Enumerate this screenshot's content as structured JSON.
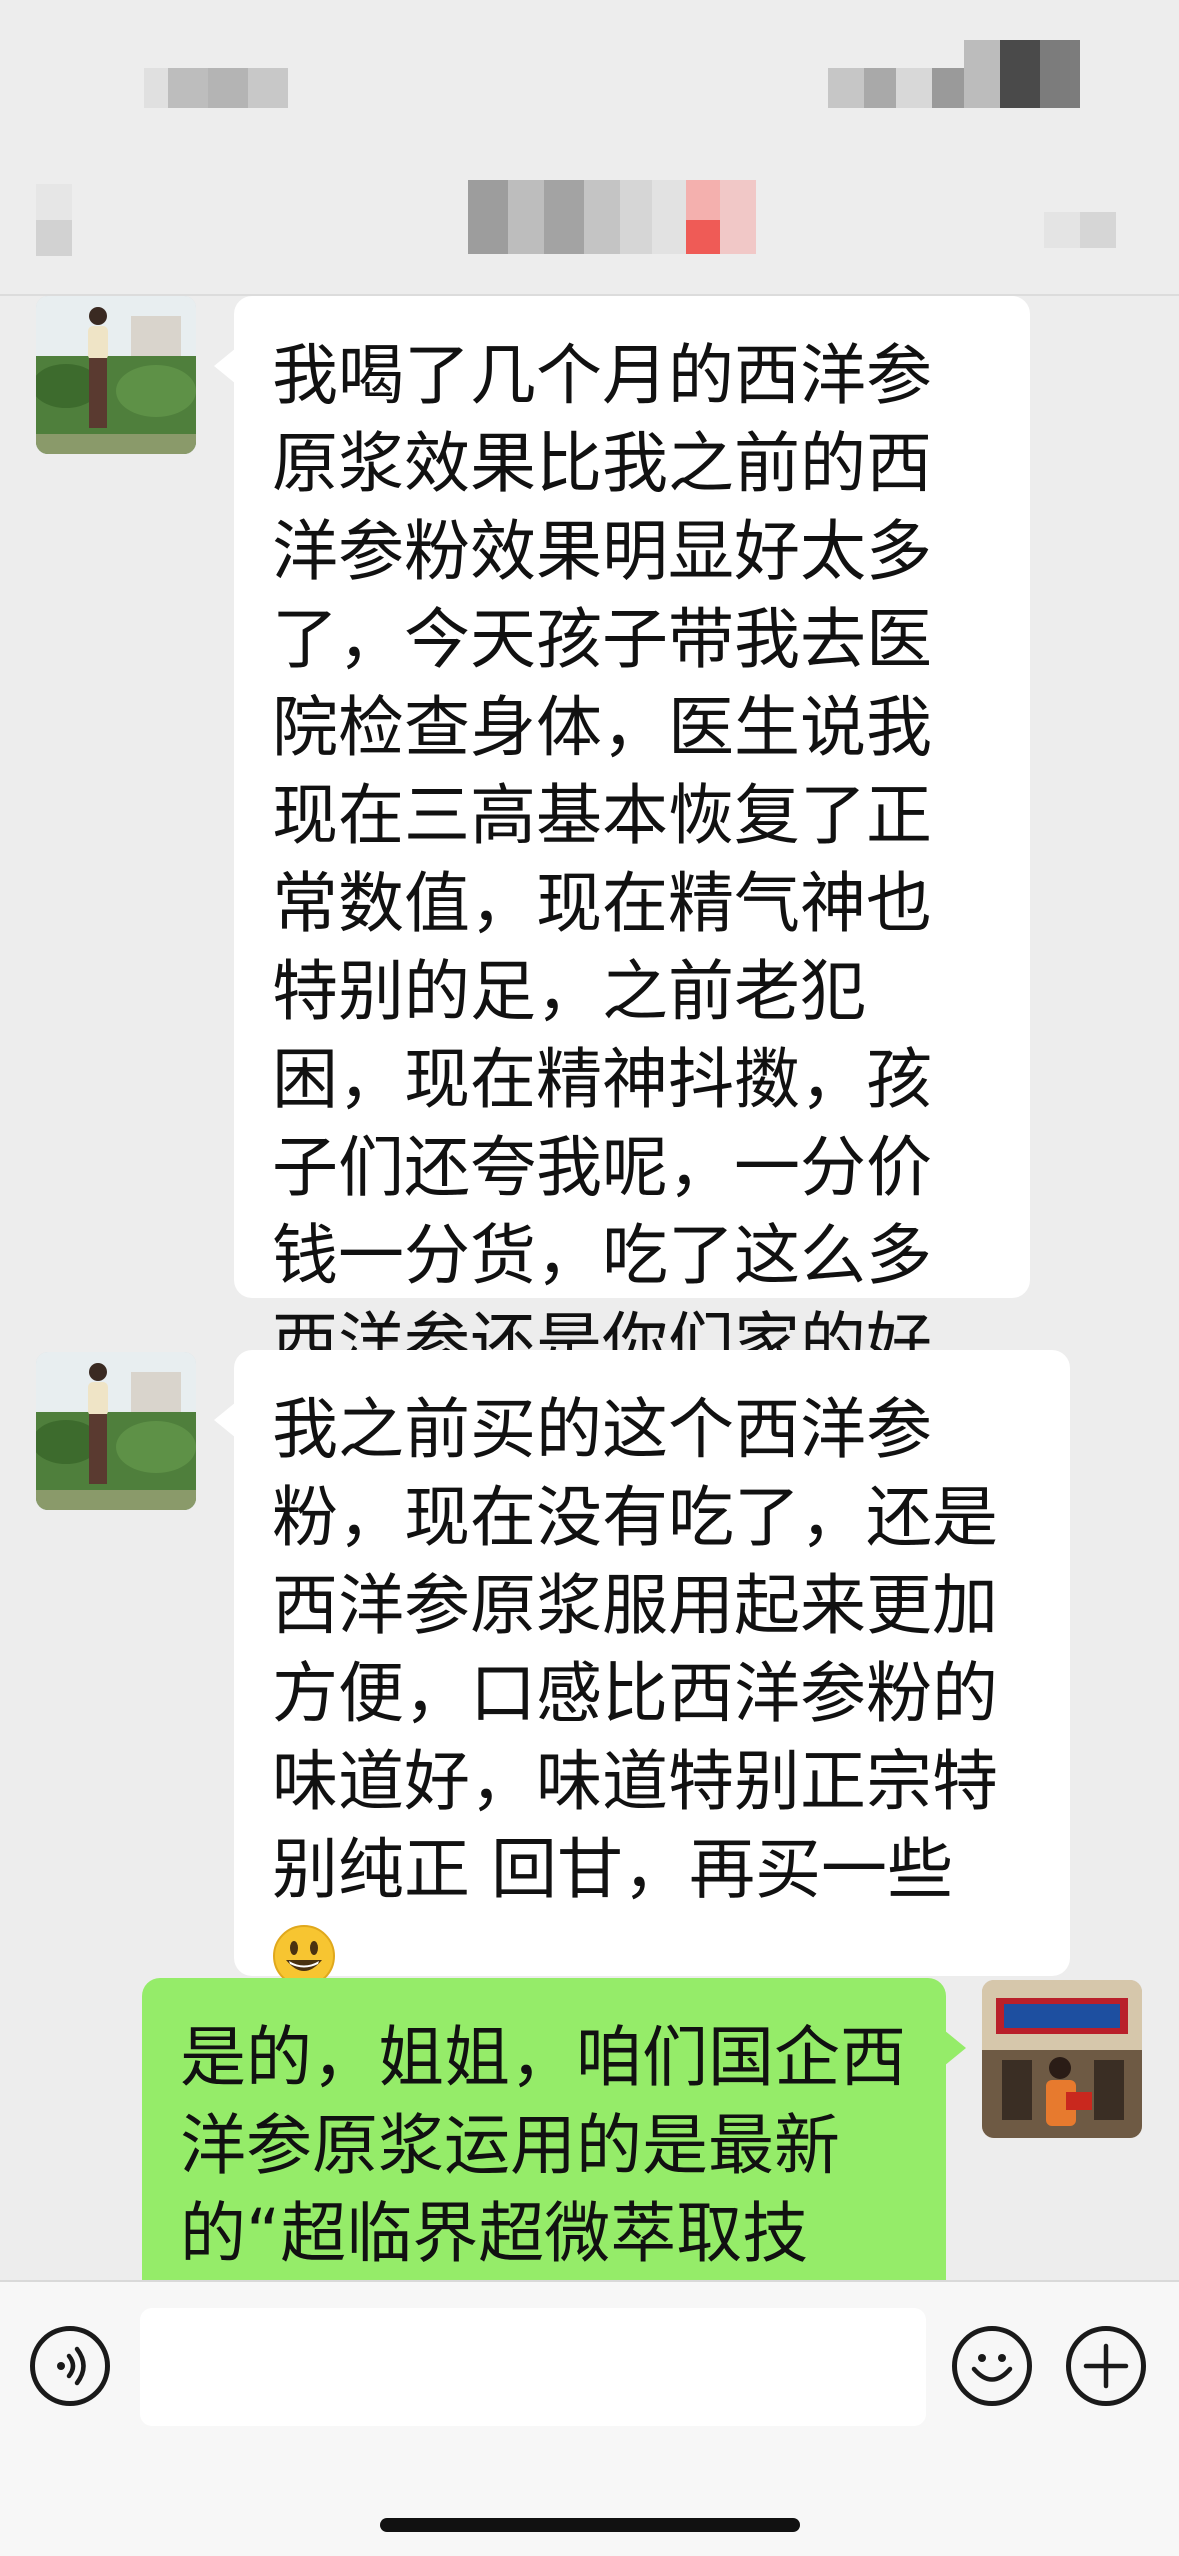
{
  "chat": {
    "messages": [
      {
        "sender": "contact",
        "text": "我喝了几个月的西洋参原浆效果比我之前的西洋参粉效果明显好太多了，今天孩子带我去医院检查身体，医生说我现在三高基本恢复了正常数值，现在精气神也特别的足，之前老犯困，现在精神抖擞，孩子们还夸我呢，一分价钱一分货，吃了这么多西洋参还是你们家的好"
      },
      {
        "sender": "contact",
        "text": "我之前买的这个西洋参粉，现在没有吃了，还是西洋参原浆服用起来更加方便，口感比西洋参粉的味道好，味道特别正宗特别纯正 回甘，再买一些",
        "emoji": "grinning-face"
      },
      {
        "sender": "me",
        "text": "是的，姐姐，咱们国企西洋参原浆运用的是最新的“超临界超微萃取技术”，"
      }
    ]
  },
  "colors": {
    "background": "#ededed",
    "incoming_bubble": "#ffffff",
    "outgoing_bubble": "#95ec69",
    "input_bar": "#f7f7f7"
  },
  "input_bar": {
    "voice_icon": "voice-icon",
    "emoji_icon": "emoji-icon",
    "plus_icon": "plus-icon",
    "text_value": ""
  }
}
